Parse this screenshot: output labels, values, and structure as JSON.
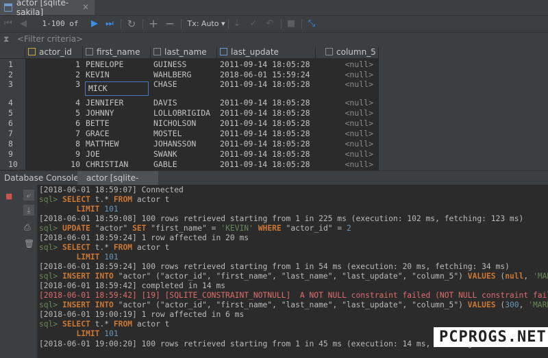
{
  "tab": {
    "title": "actor [sqlite-sakila]",
    "close": "×"
  },
  "toolbar": {
    "range": "1-100 of 101+",
    "tx": "Tx: Auto"
  },
  "filter": {
    "placeholder": "<Filter criteria>"
  },
  "table": {
    "columns": [
      "actor_id",
      "first_name",
      "last_name",
      "last_update",
      "column_5"
    ],
    "rows": [
      {
        "n": "1",
        "actor_id": "1",
        "first_name": "PENELOPE",
        "last_name": "GUINESS",
        "last_update": "2011-09-14 18:05:28",
        "column_5": "<null>"
      },
      {
        "n": "2",
        "actor_id": "2",
        "first_name": "KEVIN",
        "last_name": "WAHLBERG",
        "last_update": "2018-06-01 15:59:24",
        "column_5": "<null>"
      },
      {
        "n": "3",
        "actor_id": "3",
        "first_name": "MICK",
        "last_name": "CHASE",
        "last_update": "2011-09-14 18:05:28",
        "column_5": "<null>"
      },
      {
        "n": "4",
        "actor_id": "4",
        "first_name": "JENNIFER",
        "last_name": "DAVIS",
        "last_update": "2011-09-14 18:05:28",
        "column_5": "<null>"
      },
      {
        "n": "5",
        "actor_id": "5",
        "first_name": "JOHNNY",
        "last_name": "LOLLOBRIGIDA",
        "last_update": "2011-09-14 18:05:28",
        "column_5": "<null>"
      },
      {
        "n": "6",
        "actor_id": "6",
        "first_name": "BETTE",
        "last_name": "NICHOLSON",
        "last_update": "2011-09-14 18:05:28",
        "column_5": "<null>"
      },
      {
        "n": "7",
        "actor_id": "7",
        "first_name": "GRACE",
        "last_name": "MOSTEL",
        "last_update": "2011-09-14 18:05:28",
        "column_5": "<null>"
      },
      {
        "n": "8",
        "actor_id": "8",
        "first_name": "MATTHEW",
        "last_name": "JOHANSSON",
        "last_update": "2011-09-14 18:05:28",
        "column_5": "<null>"
      },
      {
        "n": "9",
        "actor_id": "9",
        "first_name": "JOE",
        "last_name": "SWANK",
        "last_update": "2011-09-14 18:05:28",
        "column_5": "<null>"
      },
      {
        "n": "10",
        "actor_id": "10",
        "first_name": "CHRISTIAN",
        "last_name": "GABLE",
        "last_update": "2011-09-14 18:05:28",
        "column_5": "<null>"
      }
    ]
  },
  "console": {
    "label": "Database Console:",
    "tab": "actor [sqlite-sakila]",
    "lines": [
      {
        "text": "[2018-06-01 18:59:07] Connected"
      },
      {
        "prefix": "sql>",
        "kw1": "SELECT",
        "rest1": " t.* ",
        "kw2": "FROM",
        "rest2": " actor t"
      },
      {
        "kw": "LIMIT",
        "num": "101",
        "indent": "    "
      },
      {
        "text": "[2018-06-01 18:59:08] 100 rows retrieved starting from 1 in 225 ms (execution: 102 ms, fetching: 123 ms)"
      },
      {
        "prefix": "sql>",
        "kw1": "UPDATE",
        "t1": " \"actor\" ",
        "kw2": "SET",
        "t2": " \"first_name\" = ",
        "s1": "'KEVIN'",
        "sp": " ",
        "kw3": "WHERE",
        "t3": " \"actor_id\" = ",
        "n1": "2"
      },
      {
        "text": "[2018-06-01 18:59:24] 1 row affected in 20 ms"
      },
      {
        "prefix": "sql>",
        "kw1": "SELECT",
        "rest1": " t.* ",
        "kw2": "FROM",
        "rest2": " actor t"
      },
      {
        "kw": "LIMIT",
        "num": "101",
        "indent": "    "
      },
      {
        "text": "[2018-06-01 18:59:24] 100 rows retrieved starting from 1 in 54 ms (execution: 20 ms, fetching: 34 ms)"
      },
      {
        "prefix": "sql>",
        "kw1": "INSERT INTO",
        "t1": " \"actor\" (\"actor_id\", \"first_name\", \"last_name\", \"last_update\", \"column_5\") ",
        "kw2": "VALUES",
        "t2": " (",
        "kw3": "null",
        "t3": ", ",
        "s1": "'MARK'",
        "t4": ","
      },
      {
        "text": "[2018-06-01 18:59:42] completed in 14 ms"
      },
      {
        "error": "[2018-06-01 18:59:42] [19] [SQLITE_CONSTRAINT_NOTNULL]  A NOT NULL constraint failed (NOT NULL constraint failed:"
      },
      {
        "prefix": "sql>",
        "kw1": "INSERT INTO",
        "t1": " \"actor\" (\"actor_id\", \"first_name\", \"last_name\", \"last_update\", \"column_5\") ",
        "kw2": "VALUES",
        "t2": " (",
        "n1": "300",
        "t3": ", ",
        "s1": "'MARK'",
        "t4": ","
      },
      {
        "text": "[2018-06-01 19:00:19] 1 row affected in 6 ms"
      },
      {
        "prefix": "sql>",
        "kw1": "SELECT",
        "rest1": " t.* ",
        "kw2": "FROM",
        "rest2": " actor t"
      },
      {
        "kw": "LIMIT",
        "num": "101",
        "indent": "    "
      },
      {
        "text": "[2018-06-01 19:00:20] 100 rows retrieved starting from 1 in 45 ms (execution: 14 ms, fetching: 31 ms)"
      }
    ]
  },
  "watermark": "PCPROGS.NET"
}
